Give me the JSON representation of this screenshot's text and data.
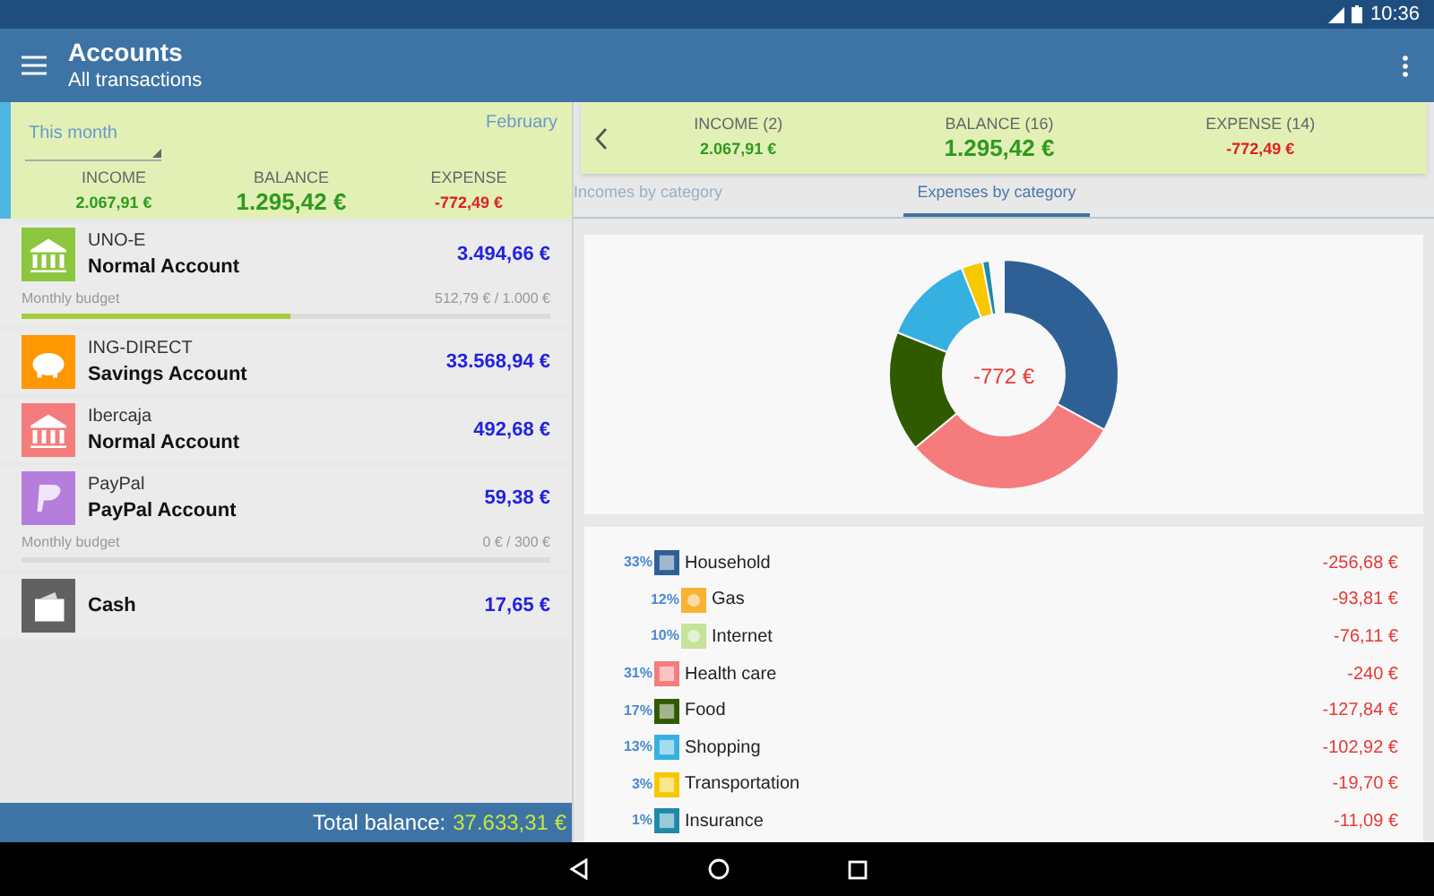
{
  "status_bar": {
    "time": "10:36"
  },
  "app_bar": {
    "title": "Accounts",
    "subtitle": "All transactions"
  },
  "summary": {
    "period": "This month",
    "month": "February",
    "income_label": "INCOME",
    "income": "2.067,91 €",
    "balance_label": "BALANCE",
    "balance": "1.295,42 €",
    "expense_label": "EXPENSE",
    "expense": "-772,49 €"
  },
  "accounts": [
    {
      "bank": "UNO-E",
      "name": "Normal Account",
      "amount": "3.494,66 €",
      "color": "#8cc63f",
      "kind": "bank",
      "budget": {
        "label": "Monthly budget",
        "reading": "512,79 € / 1.000 €",
        "level": 0.51
      }
    },
    {
      "bank": "ING-DIRECT",
      "name": "Savings Account",
      "amount": "33.568,94 €",
      "color": "#ff9800",
      "kind": "piggy"
    },
    {
      "bank": "Ibercaja",
      "name": "Normal Account",
      "amount": "492,68 €",
      "color": "#f47c7c",
      "kind": "bank"
    },
    {
      "bank": "PayPal",
      "name": "PayPal Account",
      "amount": "59,38 €",
      "color": "#b57edc",
      "kind": "paypal",
      "budget": {
        "label": "Monthly budget",
        "reading": "0 € / 300 €",
        "level": 0
      }
    },
    {
      "name": "Cash",
      "amount": "17,65 €",
      "color": "#616161",
      "kind": "wallet"
    }
  ],
  "total": {
    "label": "Total balance:",
    "value": "37.633,31 €"
  },
  "detail_summary": {
    "income_label": "INCOME (2)",
    "income": "2.067,91 €",
    "balance_label": "BALANCE (16)",
    "balance": "1.295,42 €",
    "expense_label": "EXPENSE (14)",
    "expense": "-772,49 €"
  },
  "tabs": [
    {
      "label": "Incomes by category",
      "selected": false
    },
    {
      "label": "Expenses by category",
      "selected": true
    }
  ],
  "chart": {
    "center_label": "-772 €"
  },
  "categories": [
    {
      "percent": "33%",
      "name": "Household",
      "amount": "-256,68 €",
      "color": "#2e6096",
      "kind": "main"
    },
    {
      "percent": "12%",
      "name": "Gas",
      "amount": "-93,81 €",
      "color": "#f9b233",
      "kind": "sub"
    },
    {
      "percent": "10%",
      "name": "Internet",
      "amount": "-76,11 €",
      "color": "#c5e39a",
      "kind": "sub"
    },
    {
      "percent": "31%",
      "name": "Health care",
      "amount": "-240 €",
      "color": "#f47c7c",
      "kind": "main"
    },
    {
      "percent": "17%",
      "name": "Food",
      "amount": "-127,84 €",
      "color": "#2f5a00",
      "kind": "main"
    },
    {
      "percent": "13%",
      "name": "Shopping",
      "amount": "-102,92 €",
      "color": "#35b0e0",
      "kind": "main"
    },
    {
      "percent": "3%",
      "name": "Transportation",
      "amount": "-19,70 €",
      "color": "#f7c800",
      "kind": "main"
    },
    {
      "percent": "1%",
      "name": "Insurance",
      "amount": "-11,09 €",
      "color": "#1e8aa8",
      "kind": "main"
    }
  ]
}
